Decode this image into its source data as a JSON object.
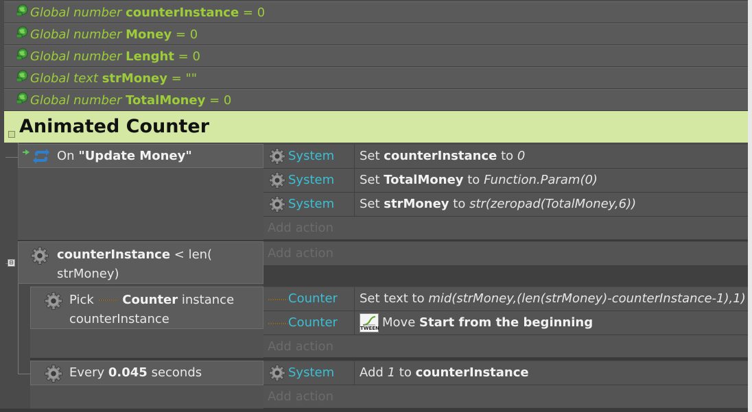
{
  "globals": [
    {
      "kind": "Global number",
      "name": "counterInstance",
      "value": "= 0"
    },
    {
      "kind": "Global number",
      "name": "Money",
      "value": "= 0"
    },
    {
      "kind": "Global number",
      "name": "Lenght",
      "value": "= 0"
    },
    {
      "kind": "Global text",
      "name": "strMoney",
      "value": "= \"\""
    },
    {
      "kind": "Global number",
      "name": "TotalMoney",
      "value": "= 0"
    }
  ],
  "group": {
    "title": "Animated Counter",
    "collapse_symbol": "⊟"
  },
  "event1": {
    "condition": {
      "prefix": "On",
      "name": "\"Update Money\""
    },
    "actions": [
      {
        "object": "System",
        "verb": "Set",
        "target": "counterInstance",
        "to": "to",
        "value": "0"
      },
      {
        "object": "System",
        "verb": "Set",
        "target": "TotalMoney",
        "to": "to",
        "value": "Function.Param(0)"
      },
      {
        "object": "System",
        "verb": "Set",
        "target": "strMoney",
        "to": "to",
        "value": "str(zeropad(TotalMoney,6))"
      }
    ],
    "add_action": "Add action"
  },
  "event2": {
    "condition": {
      "name": "counterInstance",
      "rest_line1": "< len(",
      "rest_line2": "strMoney)"
    },
    "add_action": "Add action",
    "collapse_symbol": "⊟",
    "sub1": {
      "condition": {
        "pick": "Pick",
        "object": "Counter",
        "rest": "instance",
        "line2": "counterInstance"
      },
      "actions": [
        {
          "object": "Counter",
          "verb": "Set text to",
          "value": "mid(strMoney,(len(strMoney)-counterInstance-1),1)"
        },
        {
          "object": "Counter",
          "verb": "Move",
          "target": "Start from the beginning",
          "icon_label": "TWEEN"
        }
      ],
      "add_action": "Add action"
    },
    "sub2": {
      "condition": {
        "prefix": "Every",
        "value": "0.045",
        "suffix": "seconds"
      },
      "actions": [
        {
          "object": "System",
          "verb": "Add",
          "value": "1",
          "to": "to",
          "target": "counterInstance"
        }
      ],
      "add_action": "Add action"
    }
  },
  "colors": {
    "group_bg": "#d4e8a4",
    "global_text": "#9ccc3a",
    "object_text": "#3bbfd4",
    "background": "#4a4a4a"
  }
}
